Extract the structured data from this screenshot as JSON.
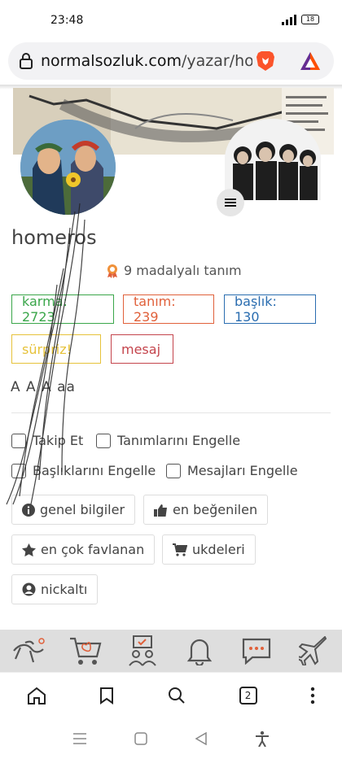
{
  "status": {
    "time": "23:48",
    "battery": "18"
  },
  "browser": {
    "url_domain": "normalsozluk.com",
    "url_path": "/yazar/hom",
    "tab_count": "2"
  },
  "profile": {
    "username": "homeros",
    "medal_text": "9 madalyalı tanım",
    "stats": {
      "karma": "karma: 2723",
      "tanim": "tanım: 239",
      "baslik": "başlık: 130",
      "surpriz": "sürpriz!",
      "mesaj": "mesaj"
    },
    "font_sizes": "A A A aa",
    "checkboxes": {
      "follow": "Takip Et",
      "block_entries": "Tanımlarını Engelle",
      "block_titles": "Başlıklarını Engelle",
      "block_messages": "Mesajları Engelle"
    },
    "buttons": {
      "general": "genel bilgiler",
      "liked": "en beğenilen",
      "faved": "en çok favlanan",
      "ukde": "ukdeleri",
      "nick": "nickaltı"
    }
  },
  "colors": {
    "karma": "#3aa64a",
    "tanim": "#e0603a",
    "baslik": "#2a6db0",
    "surpriz": "#e6c23a",
    "mesaj": "#c4444c"
  },
  "icons": [
    "home-icon",
    "bookmark-icon",
    "search-icon",
    "tabs-icon",
    "more-icon"
  ]
}
